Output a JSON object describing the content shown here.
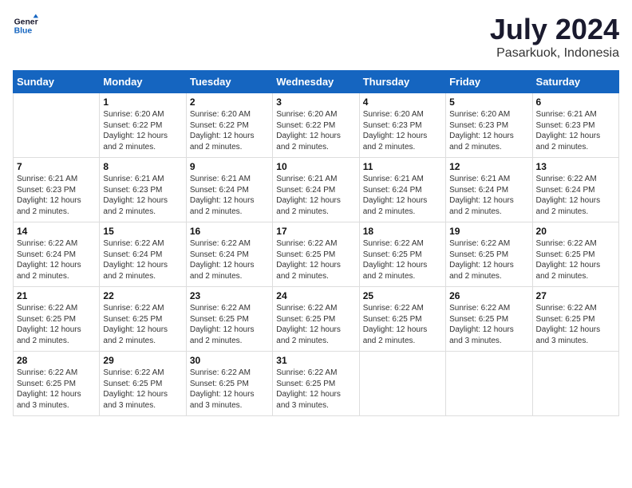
{
  "header": {
    "logo_line1": "General",
    "logo_line2": "Blue",
    "month": "July 2024",
    "location": "Pasarkuok, Indonesia"
  },
  "weekdays": [
    "Sunday",
    "Monday",
    "Tuesday",
    "Wednesday",
    "Thursday",
    "Friday",
    "Saturday"
  ],
  "weeks": [
    [
      {
        "day": "",
        "info": ""
      },
      {
        "day": "1",
        "info": "Sunrise: 6:20 AM\nSunset: 6:22 PM\nDaylight: 12 hours\nand 2 minutes."
      },
      {
        "day": "2",
        "info": "Sunrise: 6:20 AM\nSunset: 6:22 PM\nDaylight: 12 hours\nand 2 minutes."
      },
      {
        "day": "3",
        "info": "Sunrise: 6:20 AM\nSunset: 6:22 PM\nDaylight: 12 hours\nand 2 minutes."
      },
      {
        "day": "4",
        "info": "Sunrise: 6:20 AM\nSunset: 6:23 PM\nDaylight: 12 hours\nand 2 minutes."
      },
      {
        "day": "5",
        "info": "Sunrise: 6:20 AM\nSunset: 6:23 PM\nDaylight: 12 hours\nand 2 minutes."
      },
      {
        "day": "6",
        "info": "Sunrise: 6:21 AM\nSunset: 6:23 PM\nDaylight: 12 hours\nand 2 minutes."
      }
    ],
    [
      {
        "day": "7",
        "info": "Sunrise: 6:21 AM\nSunset: 6:23 PM\nDaylight: 12 hours\nand 2 minutes."
      },
      {
        "day": "8",
        "info": "Sunrise: 6:21 AM\nSunset: 6:23 PM\nDaylight: 12 hours\nand 2 minutes."
      },
      {
        "day": "9",
        "info": "Sunrise: 6:21 AM\nSunset: 6:24 PM\nDaylight: 12 hours\nand 2 minutes."
      },
      {
        "day": "10",
        "info": "Sunrise: 6:21 AM\nSunset: 6:24 PM\nDaylight: 12 hours\nand 2 minutes."
      },
      {
        "day": "11",
        "info": "Sunrise: 6:21 AM\nSunset: 6:24 PM\nDaylight: 12 hours\nand 2 minutes."
      },
      {
        "day": "12",
        "info": "Sunrise: 6:21 AM\nSunset: 6:24 PM\nDaylight: 12 hours\nand 2 minutes."
      },
      {
        "day": "13",
        "info": "Sunrise: 6:22 AM\nSunset: 6:24 PM\nDaylight: 12 hours\nand 2 minutes."
      }
    ],
    [
      {
        "day": "14",
        "info": "Sunrise: 6:22 AM\nSunset: 6:24 PM\nDaylight: 12 hours\nand 2 minutes."
      },
      {
        "day": "15",
        "info": "Sunrise: 6:22 AM\nSunset: 6:24 PM\nDaylight: 12 hours\nand 2 minutes."
      },
      {
        "day": "16",
        "info": "Sunrise: 6:22 AM\nSunset: 6:24 PM\nDaylight: 12 hours\nand 2 minutes."
      },
      {
        "day": "17",
        "info": "Sunrise: 6:22 AM\nSunset: 6:25 PM\nDaylight: 12 hours\nand 2 minutes."
      },
      {
        "day": "18",
        "info": "Sunrise: 6:22 AM\nSunset: 6:25 PM\nDaylight: 12 hours\nand 2 minutes."
      },
      {
        "day": "19",
        "info": "Sunrise: 6:22 AM\nSunset: 6:25 PM\nDaylight: 12 hours\nand 2 minutes."
      },
      {
        "day": "20",
        "info": "Sunrise: 6:22 AM\nSunset: 6:25 PM\nDaylight: 12 hours\nand 2 minutes."
      }
    ],
    [
      {
        "day": "21",
        "info": "Sunrise: 6:22 AM\nSunset: 6:25 PM\nDaylight: 12 hours\nand 2 minutes."
      },
      {
        "day": "22",
        "info": "Sunrise: 6:22 AM\nSunset: 6:25 PM\nDaylight: 12 hours\nand 2 minutes."
      },
      {
        "day": "23",
        "info": "Sunrise: 6:22 AM\nSunset: 6:25 PM\nDaylight: 12 hours\nand 2 minutes."
      },
      {
        "day": "24",
        "info": "Sunrise: 6:22 AM\nSunset: 6:25 PM\nDaylight: 12 hours\nand 2 minutes."
      },
      {
        "day": "25",
        "info": "Sunrise: 6:22 AM\nSunset: 6:25 PM\nDaylight: 12 hours\nand 2 minutes."
      },
      {
        "day": "26",
        "info": "Sunrise: 6:22 AM\nSunset: 6:25 PM\nDaylight: 12 hours\nand 3 minutes."
      },
      {
        "day": "27",
        "info": "Sunrise: 6:22 AM\nSunset: 6:25 PM\nDaylight: 12 hours\nand 3 minutes."
      }
    ],
    [
      {
        "day": "28",
        "info": "Sunrise: 6:22 AM\nSunset: 6:25 PM\nDaylight: 12 hours\nand 3 minutes."
      },
      {
        "day": "29",
        "info": "Sunrise: 6:22 AM\nSunset: 6:25 PM\nDaylight: 12 hours\nand 3 minutes."
      },
      {
        "day": "30",
        "info": "Sunrise: 6:22 AM\nSunset: 6:25 PM\nDaylight: 12 hours\nand 3 minutes."
      },
      {
        "day": "31",
        "info": "Sunrise: 6:22 AM\nSunset: 6:25 PM\nDaylight: 12 hours\nand 3 minutes."
      },
      {
        "day": "",
        "info": ""
      },
      {
        "day": "",
        "info": ""
      },
      {
        "day": "",
        "info": ""
      }
    ]
  ]
}
